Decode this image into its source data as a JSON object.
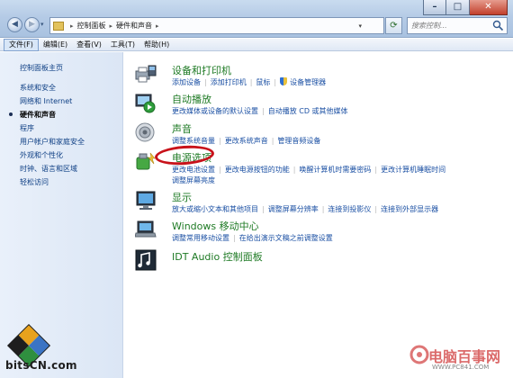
{
  "window": {
    "minimize_label": "–",
    "maximize_label": "□",
    "close_label": "✕"
  },
  "address_bar": {
    "crumbs": [
      "控制面板",
      "硬件和声音"
    ],
    "search_placeholder": "搜索控制..."
  },
  "menu": [
    "文件(F)",
    "编辑(E)",
    "查看(V)",
    "工具(T)",
    "帮助(H)"
  ],
  "sidebar": {
    "items": [
      "控制面板主页",
      "系统和安全",
      "网络和 Internet",
      "硬件和声音",
      "程序",
      "用户帐户和家庭安全",
      "外观和个性化",
      "时钟、语言和区域",
      "轻松访问"
    ],
    "current_index": 3
  },
  "categories": [
    {
      "title": "设备和打印机",
      "icon": "printer-icon",
      "links": [
        "添加设备",
        "添加打印机",
        "鼠标",
        "设备管理器"
      ]
    },
    {
      "title": "自动播放",
      "icon": "autoplay-icon",
      "links": [
        "更改媒体或设备的默认设置",
        "自动播放 CD 或其他媒体"
      ]
    },
    {
      "title": "声音",
      "icon": "speaker-icon",
      "links": [
        "调整系统音量",
        "更改系统声音",
        "管理音频设备"
      ]
    },
    {
      "title": "电源选项",
      "icon": "power-icon",
      "links": [
        "更改电池设置",
        "更改电源按钮的功能",
        "唤醒计算机时需要密码",
        "更改计算机睡眠时间"
      ],
      "links_row2": "调整屏幕亮度"
    },
    {
      "title": "显示",
      "icon": "display-icon",
      "links": [
        "放大或缩小文本和其他项目",
        "调整屏幕分辨率",
        "连接到投影仪",
        "连接到外部显示器"
      ]
    },
    {
      "title": "Windows 移动中心",
      "icon": "mobility-icon",
      "links": [
        "调整常用移动设置",
        "在给出演示文稿之前调整设置"
      ]
    },
    {
      "title": "IDT Audio 控制面板",
      "icon": "idt-audio-icon",
      "links": []
    }
  ],
  "watermarks": {
    "left": "bitsCN.com",
    "right_title": "电脑百事网",
    "right_url": "WWW.PC841.COM"
  },
  "colors": {
    "link": "#1a4fa3",
    "category_title": "#1e7a24",
    "highlight_ellipse": "#c8121a"
  }
}
